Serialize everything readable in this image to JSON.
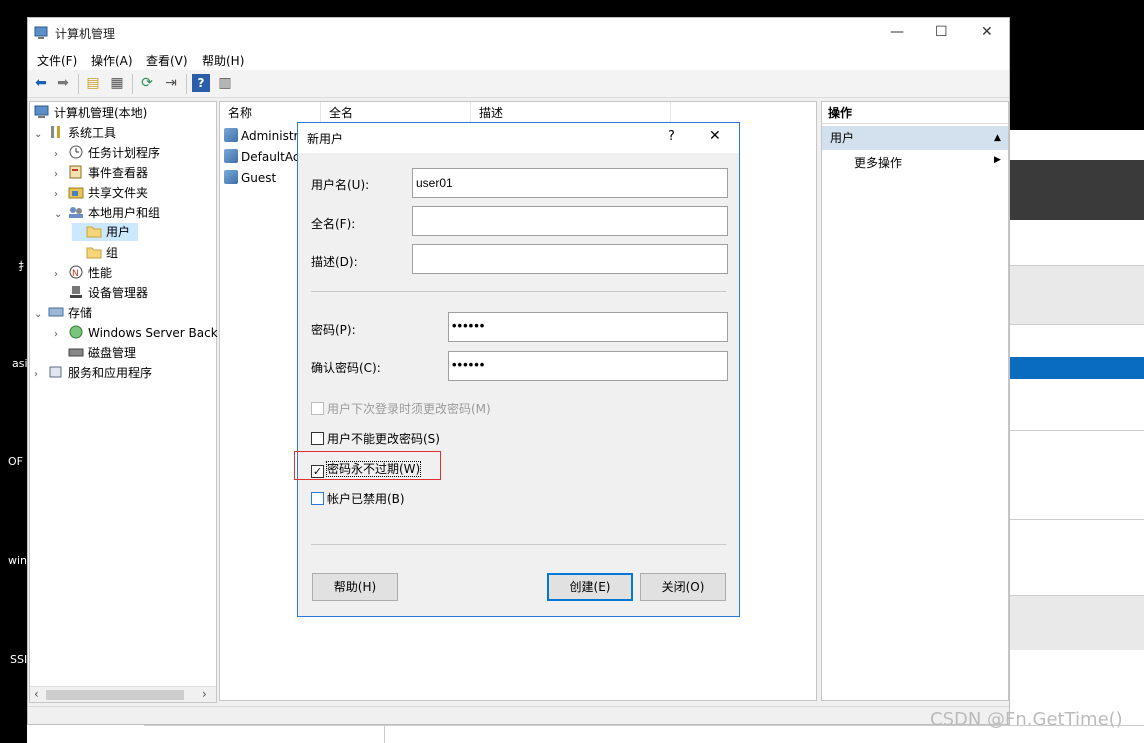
{
  "window": {
    "title": "计算机管理",
    "minimize": "—",
    "maximize": "☐",
    "close": "✕"
  },
  "menu": [
    "文件(F)",
    "操作(A)",
    "查看(V)",
    "帮助(H)"
  ],
  "toolbar": {
    "icons": [
      "back-icon",
      "forward-icon",
      "up-folder-icon",
      "show-tree-icon",
      "refresh-icon",
      "export-icon",
      "help-icon",
      "properties-icon"
    ]
  },
  "tree": {
    "root": "计算机管理(本地)",
    "system_tools": "系统工具",
    "task_scheduler": "任务计划程序",
    "event_viewer": "事件查看器",
    "shared_folders": "共享文件夹",
    "local_users_groups": "本地用户和组",
    "users": "用户",
    "groups": "组",
    "performance": "性能",
    "device_manager": "设备管理器",
    "storage": "存储",
    "windows_server_backup": "Windows Server Back",
    "disk_management": "磁盘管理",
    "services_apps": "服务和应用程序"
  },
  "list": {
    "columns": [
      "名称",
      "全名",
      "描述"
    ],
    "rows": [
      "Administr",
      "DefaultAc",
      "Guest"
    ]
  },
  "actions": {
    "header": "操作",
    "section": "用户",
    "more": "更多操作"
  },
  "dialog": {
    "title": "新用户",
    "help_glyph": "?",
    "close_glyph": "✕",
    "username_label": "用户名(U):",
    "username_value": "user01",
    "fullname_label": "全名(F):",
    "fullname_value": "",
    "description_label": "描述(D):",
    "description_value": "",
    "password_label": "密码(P):",
    "password_value": "••••••",
    "confirm_label": "确认密码(C):",
    "confirm_value": "••••••",
    "cb_must_change": "用户下次登录时须更改密码(M)",
    "cb_cannot_change": "用户不能更改密码(S)",
    "cb_never_expires": "密码永不过期(W)",
    "cb_disabled": "帐户已禁用(B)",
    "cb_must_change_checked": false,
    "cb_must_change_enabled": false,
    "cb_cannot_change_checked": false,
    "cb_never_expires_checked": true,
    "cb_disabled_checked": false,
    "help_button": "帮助(H)",
    "create_button": "创建(E)",
    "close_button": "关闭(O)"
  },
  "desktop_labels": [
    "扌",
    "asi",
    "OF",
    "win",
    "SSI"
  ],
  "watermark": "CSDN @Fn.GetTime()",
  "colors": {
    "accent": "#0078d7",
    "highlight_box": "#e03030",
    "selection": "#cce8ff",
    "action_header": "#d3e0ee"
  }
}
